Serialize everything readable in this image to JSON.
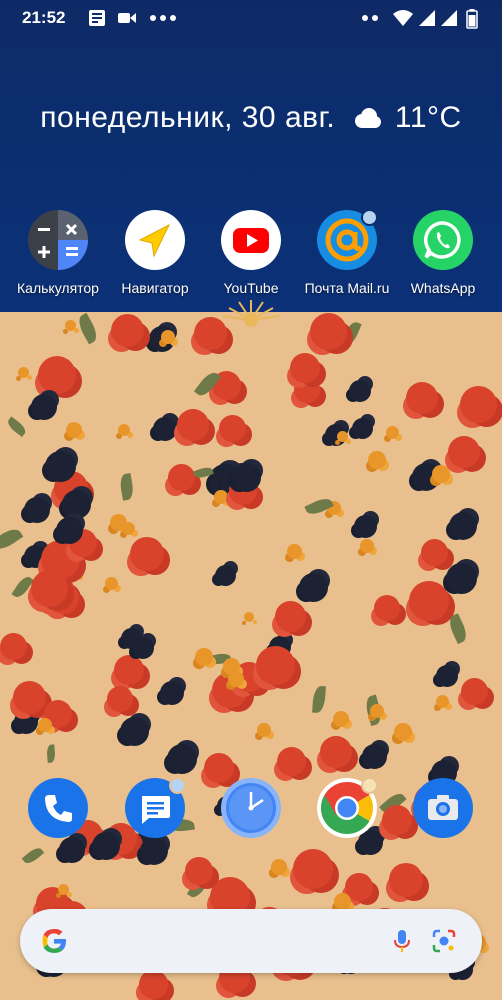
{
  "status_bar": {
    "time": "21:52",
    "left_icons": [
      "news-icon",
      "video-camera-icon",
      "more-dots-icon"
    ],
    "right_icons": [
      "dual-dots-icon",
      "wifi-icon",
      "signal-icon",
      "signal-icon",
      "battery-icon"
    ]
  },
  "glance": {
    "date": "понедельник, 30 авг.",
    "weather_icon": "cloud-icon",
    "temperature": "11°C"
  },
  "apps": [
    {
      "label": "Калькулятор",
      "icon": "calculator-icon"
    },
    {
      "label": "Навигатор",
      "icon": "navigator-arrow-icon"
    },
    {
      "label": "YouTube",
      "icon": "youtube-play-icon"
    },
    {
      "label": "Почта Mail.ru",
      "icon": "at-sign-icon",
      "has_notification": true
    },
    {
      "label": "WhatsApp",
      "icon": "whatsapp-icon"
    }
  ],
  "dock": [
    {
      "name": "phone",
      "icon": "phone-icon"
    },
    {
      "name": "messages",
      "icon": "messages-icon",
      "has_notification": true
    },
    {
      "name": "clock",
      "icon": "clock-icon"
    },
    {
      "name": "chrome",
      "icon": "chrome-icon",
      "has_notification": true
    },
    {
      "name": "camera",
      "icon": "camera-icon"
    }
  ],
  "search": {
    "logo": "google-g-icon",
    "voice": "mic-icon",
    "lens": "lens-icon"
  },
  "colors": {
    "wallpaper_top": "#0b2e6f",
    "wallpaper_floral_bg": "#e9c08d",
    "poppy": "#d9432c",
    "iris": "#1c2234",
    "marigold": "#e8962a",
    "notification_dot": "#b7d3f2"
  }
}
